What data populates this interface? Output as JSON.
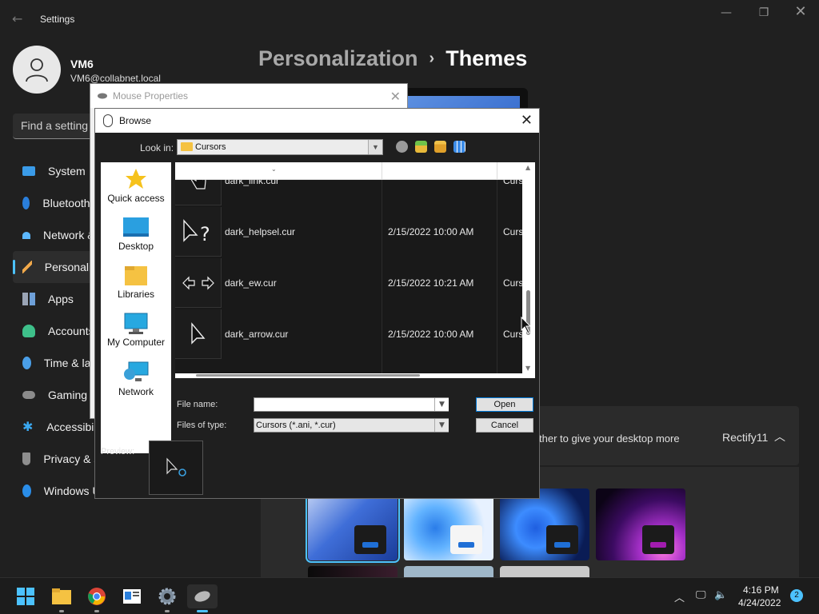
{
  "settings": {
    "app_title": "Settings",
    "user": {
      "name": "VM6",
      "email": "VM6@collabnet.local"
    },
    "search_placeholder": "Find a setting",
    "nav": [
      {
        "label": "System",
        "icon": "monitor-icon"
      },
      {
        "label": "Bluetooth & devices",
        "icon": "bluetooth-icon"
      },
      {
        "label": "Network & internet",
        "icon": "wifi-icon"
      },
      {
        "label": "Personalization",
        "icon": "brush-icon",
        "active": true
      },
      {
        "label": "Apps",
        "icon": "apps-icon"
      },
      {
        "label": "Accounts",
        "icon": "person-icon"
      },
      {
        "label": "Time & language",
        "icon": "clock-icon"
      },
      {
        "label": "Gaming",
        "icon": "gamepad-icon"
      },
      {
        "label": "Accessibility",
        "icon": "accessibility-icon"
      },
      {
        "label": "Privacy & security",
        "icon": "shield-icon"
      },
      {
        "label": "Windows Update",
        "icon": "update-icon"
      }
    ],
    "breadcrumb": {
      "parent": "Personalization",
      "separator": "›",
      "current": "Themes"
    },
    "theme_section": {
      "description": "ther to give your desktop more",
      "current_theme": "Rectify11"
    },
    "accent_color": "#4cc2ff"
  },
  "mouse_properties": {
    "title": "Mouse Properties"
  },
  "browse_dialog": {
    "title": "Browse",
    "look_in_label": "Look in:",
    "look_in_value": "Cursors",
    "toolbar_icons": [
      "back-icon",
      "up-folder-icon",
      "new-folder-icon",
      "view-menu-icon"
    ],
    "places": [
      {
        "label": "Quick access",
        "icon": "star-icon"
      },
      {
        "label": "Desktop",
        "icon": "desktop-icon"
      },
      {
        "label": "Libraries",
        "icon": "libraries-icon"
      },
      {
        "label": "My Computer",
        "icon": "computer-icon"
      },
      {
        "label": "Network",
        "icon": "network-icon"
      }
    ],
    "files": [
      {
        "name": "dark_link.cur",
        "date": "",
        "type": "Cursor"
      },
      {
        "name": "dark_helpsel.cur",
        "date": "2/15/2022 10:00 AM",
        "type": "Cursor"
      },
      {
        "name": "dark_ew.cur",
        "date": "2/15/2022 10:21 AM",
        "type": "Cursor"
      },
      {
        "name": "dark_arrow.cur",
        "date": "2/15/2022 10:00 AM",
        "type": "Cursor"
      }
    ],
    "file_name_label": "File name:",
    "file_name_value": "",
    "files_of_type_label": "Files of type:",
    "files_of_type_value": "Cursors (*.ani, *.cur)",
    "open_label": "Open",
    "cancel_label": "Cancel",
    "preview_label": "Preview:"
  },
  "taskbar": {
    "apps": [
      "start-icon",
      "file-explorer-icon",
      "chrome-icon",
      "news-icon",
      "settings-icon",
      "mouse-properties-icon"
    ],
    "time": "4:16 PM",
    "date": "4/24/2022",
    "notification_count": "2"
  }
}
